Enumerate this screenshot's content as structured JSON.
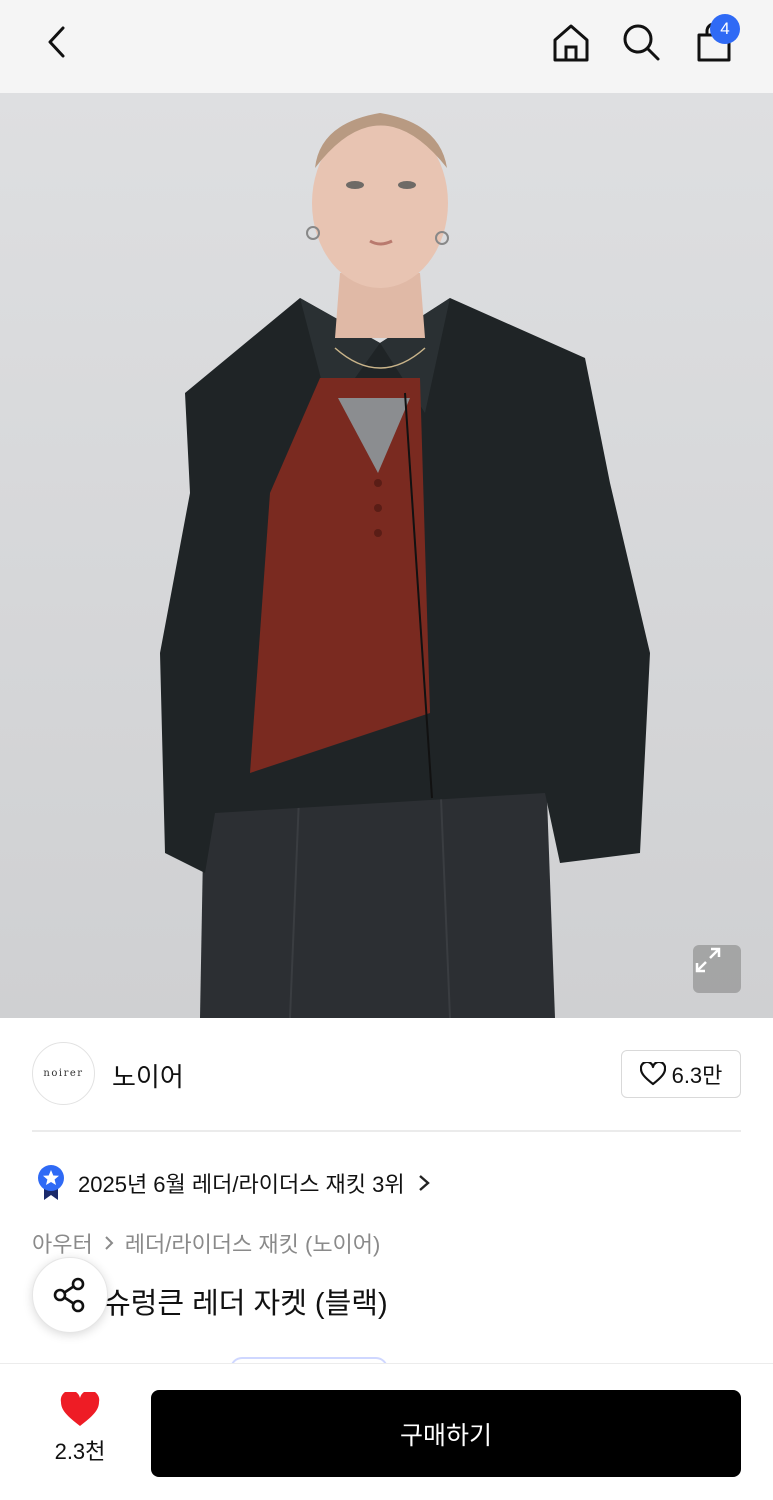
{
  "header": {
    "cart_count": "4"
  },
  "brand": {
    "logo_text": "noirer",
    "name": "노이어",
    "like_count": "6.3만"
  },
  "ranking": {
    "text": "2025년 6월 레더/라이더스 재킷 3위"
  },
  "breadcrumb": {
    "items": [
      "아우터",
      "레더/라이더스 재킷 (노이어)"
    ]
  },
  "product": {
    "title": "슈렁큰 레더 자켓 (블랙)"
  },
  "bottom_bar": {
    "wish_count": "2.3천",
    "buy_label": "구매하기"
  },
  "colors": {
    "accent_blue": "#2f6af5",
    "wish_red": "#ee1c25",
    "buy_button_bg": "#000000"
  },
  "icons": [
    "back-arrow-icon",
    "home-icon",
    "search-icon",
    "shopping-bag-icon",
    "expand-icon",
    "heart-outline-icon",
    "ranking-badge-icon",
    "chevron-right-icon",
    "share-icon",
    "heart-filled-icon"
  ]
}
